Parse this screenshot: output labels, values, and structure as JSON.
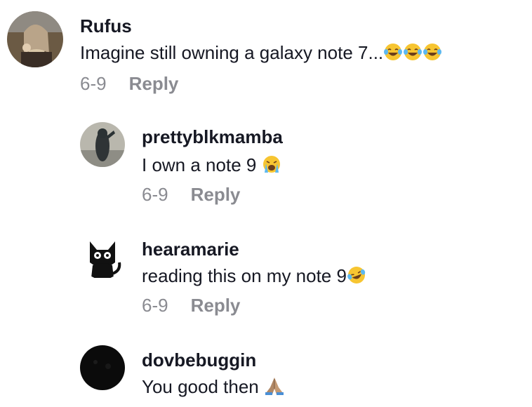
{
  "comments": [
    {
      "username": "Rufus",
      "text": "Imagine still owning a galaxy note 7...",
      "emojis": [
        "laughing-tears-emoji",
        "laughing-tears-emoji",
        "laughing-tears-emoji"
      ],
      "date": "6-9",
      "reply_label": "Reply"
    },
    {
      "username": "prettyblkmamba",
      "text": "I own a note 9",
      "emojis": [
        "loudly-crying-emoji"
      ],
      "date": "6-9",
      "reply_label": "Reply"
    },
    {
      "username": "hearamarie",
      "text": "reading this on my note 9",
      "emojis": [
        "rolling-laughing-emoji"
      ],
      "date": "6-9",
      "reply_label": "Reply"
    },
    {
      "username": "dovbebuggin",
      "text": "You good then",
      "emojis": [
        "folded-hands-emoji"
      ]
    }
  ],
  "colors": {
    "text": "#161823",
    "meta": "#8a8b91",
    "emoji_yellow": "#f7c531"
  }
}
